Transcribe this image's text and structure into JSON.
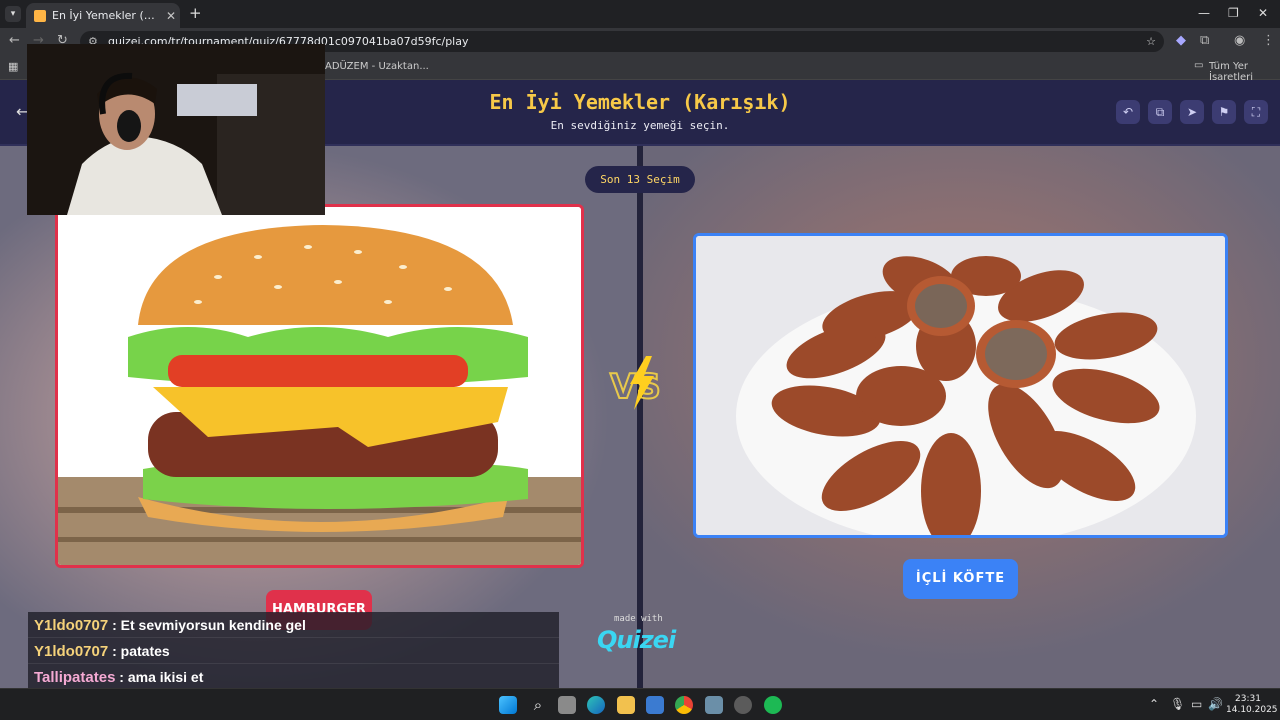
{
  "browser": {
    "tab_title": "En İyi Yemekler (Karışık) - Quizei",
    "tab_menu_icon": "chevron-down-icon",
    "new_tab_glyph": "+",
    "url": "quizei.com/tr/tournament/quiz/67778d01c097041ba07d59fc/play",
    "bookmark_partial": "ADÜZEM - Uzaktan...",
    "all_bookmarks": "Tüm Yer İşaretleri"
  },
  "quiz": {
    "title": "En İyi Yemekler (Karışık)",
    "subtitle": "En sevdiğiniz yemeği seçin.",
    "round_pill": "Son 13 Seçim",
    "left": {
      "name": "HAMBURGER",
      "accent": "#e0314b"
    },
    "right": {
      "name": "İÇLİ KÖFTE",
      "accent": "#3b82f6"
    },
    "vs": "VS",
    "made_with": "made with",
    "brand": "Quizei"
  },
  "chat": [
    {
      "user": "Y1ldo0707",
      "message": "Et sevmiyorsun kendine gel"
    },
    {
      "user": "Y1ldo0707",
      "message": "patates"
    },
    {
      "user": "Tallipatates",
      "message": "ama ikisi et"
    }
  ],
  "taskbar": {
    "time": "23:31",
    "date": "14.10.2025"
  }
}
